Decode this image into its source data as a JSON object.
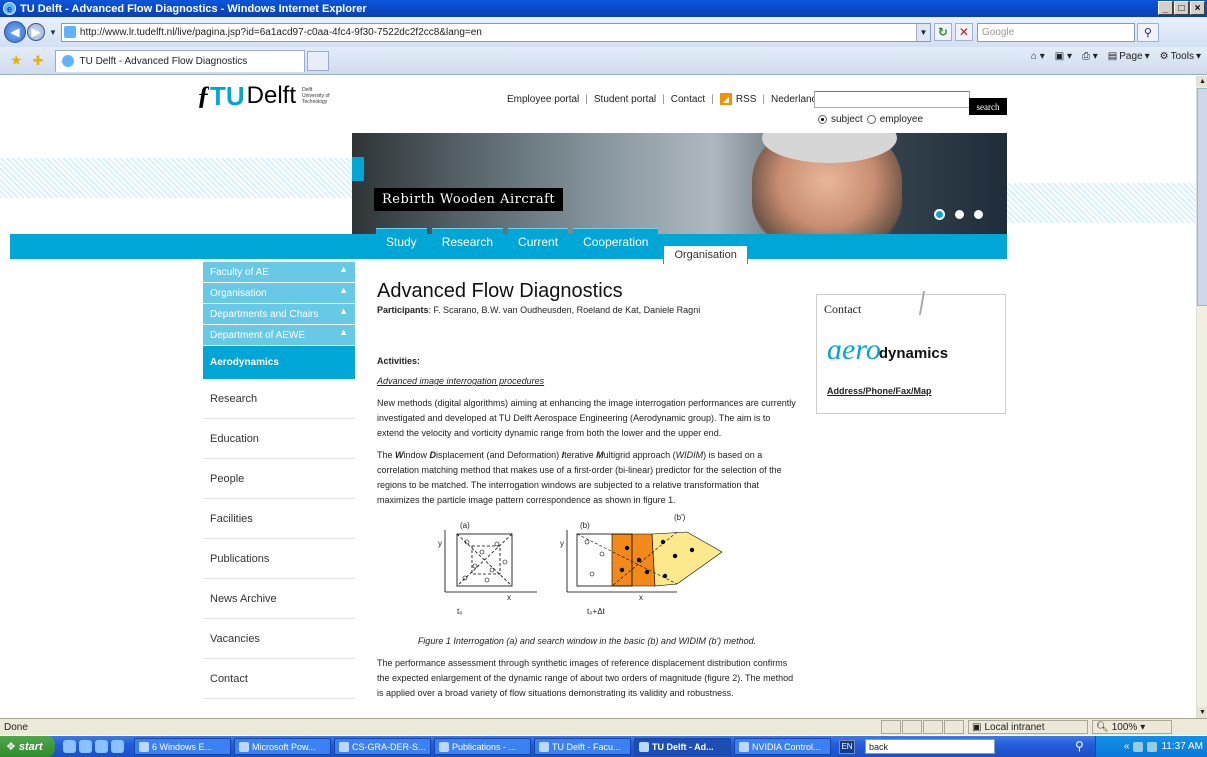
{
  "window": {
    "title": "TU Delft - Advanced Flow Diagnostics - Windows Internet Explorer",
    "buttons": [
      "_",
      "8",
      "X"
    ]
  },
  "address": {
    "url": "http://www.lr.tudelft.nl/live/pagina.jsp?id=6a1acd97-c0aa-4fc4-9f30-7522dc2f2cc8&lang=en",
    "search_placeholder": "Google"
  },
  "tabs": {
    "active_tab": "TU Delft - Advanced Flow Diagnostics",
    "commands": [
      "Page",
      "Tools"
    ]
  },
  "site": {
    "logo_tu": "TU",
    "logo_delft": "Delft",
    "logo_sub": "Delft University of Technology",
    "toplinks": [
      "Employee portal",
      "Student portal",
      "Contact",
      "RSS",
      "Nederlands"
    ],
    "search_button": "search",
    "radio_subject": "subject",
    "radio_employee": "employee",
    "banner_caption": "Rebirth Wooden Aircraft",
    "nav_tabs": [
      "Study",
      "Research",
      "Current",
      "Cooperation"
    ],
    "nav_active": "Organisation"
  },
  "leftnav": {
    "parents": [
      "Faculty of AE",
      "Organisation",
      "Departments and Chairs",
      "Department of AEWE"
    ],
    "active": "Aerodynamics",
    "links": [
      "Research",
      "Education",
      "People",
      "Facilities",
      "Publications",
      "News Archive",
      "Vacancies",
      "Contact"
    ]
  },
  "article": {
    "title": "Advanced Flow Diagnostics",
    "participants_label": "Participants",
    "participants": ": F. Scarano,  B.W. van Oudheusden, Roeland de Kat, Daniele Ragni",
    "activities": "Activities:",
    "sublink": "Advanced image interrogation procedures",
    "p1": "New methods (digital algorithms) aiming at enhancing the image interrogation performances are currently investigated and developed at TU Delft Aerospace Engineering (Aerodynamic group). The aim is to extend the velocity and vorticity dynamic range from both the lower and the upper end.",
    "p2_a": "The ",
    "p2_W": "W",
    "p2_b": "indow ",
    "p2_D": "D",
    "p2_c": "isplacement (and Deformation) ",
    "p2_I": "I",
    "p2_d": "terative ",
    "p2_M": "M",
    "p2_e": "ultigrid approach (",
    "p2_widim": "WIDIM",
    "p2_f": ") is based on a correlation matching method that makes use of a first-order (bi-linear) predictor for the selection of the regions to be matched. The interrogation windows are subjected to a relative transformation that maximizes the particle image pattern correspondence as shown in figure 1.",
    "fig_labels": [
      "(a)",
      "(b)",
      "(b')",
      "y",
      "y",
      "x",
      "x",
      "t₀",
      "t₀+Δt"
    ],
    "fig_caption": "Figure 1 Interrogation (a) and search window in the basic (b) and WIDIM (b') method.",
    "p3": "The performance assessment through synthetic images of reference displacement distribution confirms the expected enlargement of the dynamic range of about two orders of magnitude (figure 2). The method is applied over a broad variety of flow situations demonstrating its validity and robustness."
  },
  "contact": {
    "heading": "Contact",
    "logo_swirl": "ɑero",
    "logo_text": "dynamics",
    "address_link": "Address/Phone/Fax/Map"
  },
  "status": {
    "text": "Done",
    "zone": "Local intranet",
    "zoom": "100%"
  },
  "taskbar": {
    "start": "start",
    "items": [
      "6 Windows E...",
      "Microsoft Pow...",
      "CS-GRA-DER-S...",
      "Publications - ...",
      "TU Delft - Facu...",
      "TU Delft - Ad...",
      "NVIDIA Control..."
    ],
    "lang": "EN",
    "search_value": "back",
    "time": "11:37 AM"
  }
}
